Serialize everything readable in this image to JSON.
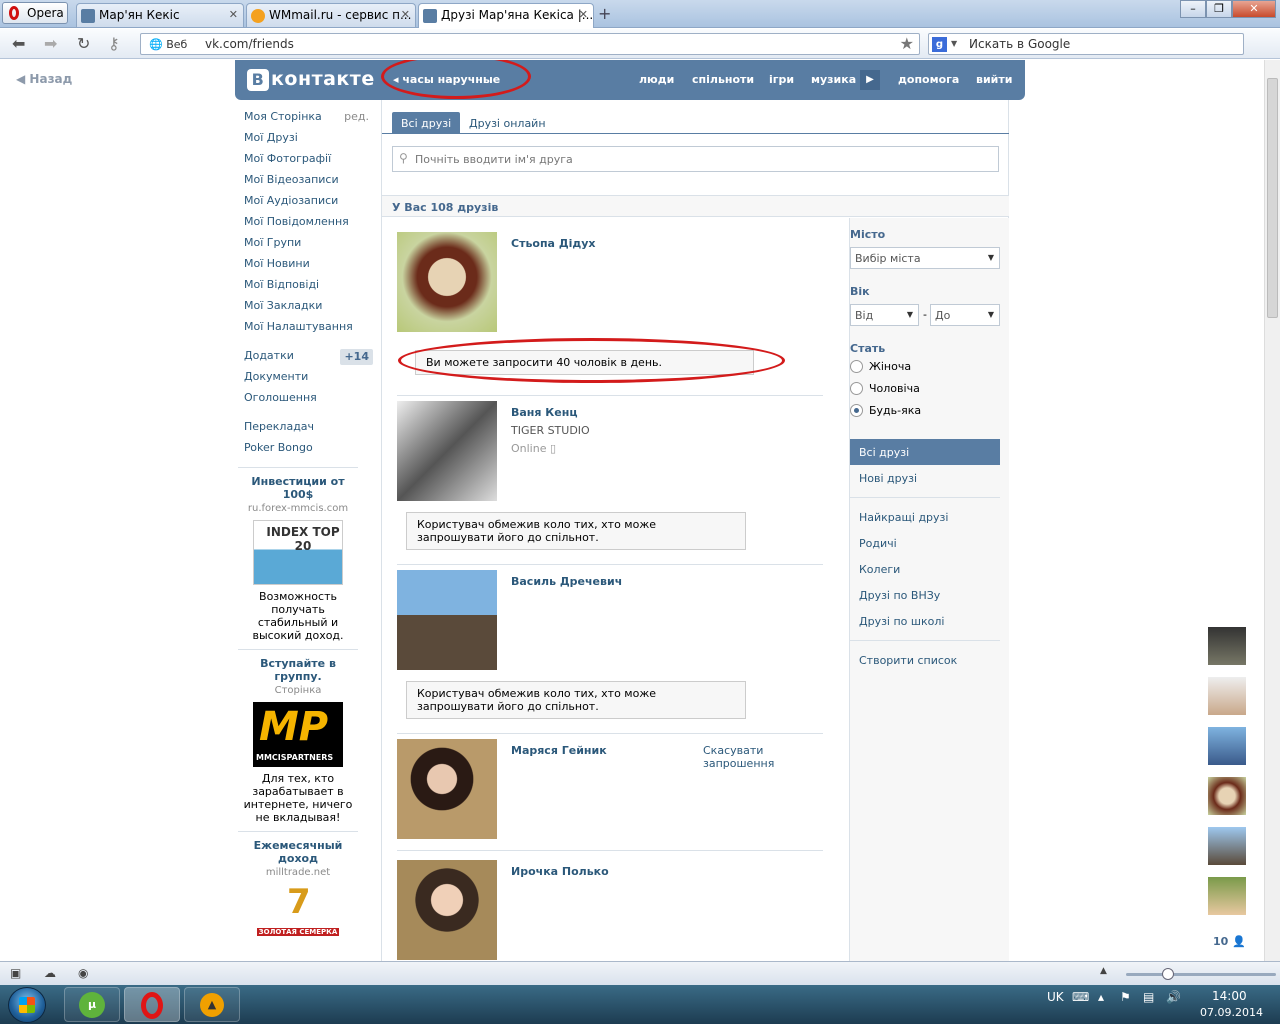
{
  "browser": {
    "app_button": "Opera",
    "tabs": [
      {
        "title": "Мар'ян Кекіс"
      },
      {
        "title": "WMmail.ru - сервис п..."
      },
      {
        "title": "Друзі Мар'яна Кекіса |..."
      }
    ],
    "address_prefix": "Веб",
    "url": "vk.com/friends",
    "search_placeholder": "Искать в Google"
  },
  "page": {
    "back": "Назад",
    "logo": "контакте",
    "logo_letter": "В",
    "status": "часы наручные",
    "nav": [
      "люди",
      "спільноти",
      "ігри",
      "музика",
      "допомога",
      "вийти"
    ],
    "left_menu": {
      "my_page": "Моя Сторінка",
      "edit": "ред.",
      "items": [
        "Мої Друзі",
        "Мої Фотографії",
        "Мої Відеозаписи",
        "Мої Аудіозаписи",
        "Мої Повідомлення",
        "Мої Групи",
        "Мої Новини",
        "Мої Відповіді",
        "Мої Закладки",
        "Мої Налаштування"
      ],
      "apps": "Додатки",
      "apps_badge": "+14",
      "docs": "Документи",
      "ads": "Оголошення",
      "extra": [
        "Перекладач",
        "Poker Bongo"
      ]
    },
    "ads": [
      {
        "title": "Инвестиции от 100$",
        "source": "ru.forex-mmcis.com",
        "image_text": "INDEX TOP 20",
        "text": "Возможность получать стабильный и высокий доход."
      },
      {
        "title": "Вступайте в группу.",
        "source": "Сторінка",
        "image_text": "MP",
        "image_sub": "MMCISPARTNERS",
        "text": "Для тех, кто зарабатывает в интернете, ничего не вкладывая!"
      },
      {
        "title": "Ежемесячный доход",
        "source": "milltrade.net",
        "image_text": "7",
        "image_sub": "ЗОЛОТАЯ СЕМЕРКА"
      }
    ],
    "tabs": {
      "all": "Всі друзі",
      "online": "Друзі онлайн"
    },
    "filter_placeholder": "Почніть вводити ім'я друга",
    "count_label": "У Вас 108 друзів",
    "friends": [
      {
        "name": "Стьопа Дідух",
        "notice": "Ви можете запросити 40 чоловік в день."
      },
      {
        "name": "Ваня Кенц",
        "sub": "TIGER STUDIO",
        "online": "Online",
        "notice": "Користувач обмежив коло тих, хто може запрошувати його до спільнот."
      },
      {
        "name": "Василь Дречевич",
        "notice": "Користувач обмежив коло тих, хто може запрошувати його до спільнот."
      },
      {
        "name": "Маряся Гейник",
        "action": "Скасувати запрошення"
      },
      {
        "name": "Ирочка Полько"
      }
    ],
    "filters": {
      "city_label": "Місто",
      "city_value": "Вибір міста",
      "age_label": "Вік",
      "age_from": "Від",
      "age_sep": "-",
      "age_to": "До",
      "gender_label": "Стать",
      "gender_options": [
        "Жіноча",
        "Чоловіча",
        "Будь-яка"
      ],
      "gender_selected": 2
    },
    "right_links": {
      "selected": "Всі друзі",
      "new": "Нові друзі",
      "groups": [
        "Найкращі друзі",
        "Родичі",
        "Колеги",
        "Друзі по ВНЗу",
        "Друзі по школі"
      ],
      "create": "Створити список"
    },
    "online_count": "10"
  },
  "taskbar": {
    "lang": "UK",
    "time": "14:00",
    "date": "07.09.2014"
  },
  "colors": {
    "vk_blue": "#597da3",
    "link": "#2b587a",
    "annotation_red": "#d31b1b"
  }
}
